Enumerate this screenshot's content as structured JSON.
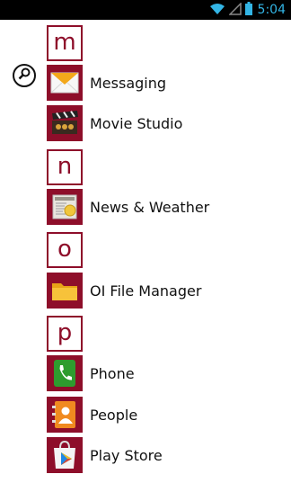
{
  "status_bar": {
    "time": "5:04",
    "icons": [
      "wifi-icon",
      "signal-icon",
      "battery-icon"
    ]
  },
  "search": {
    "icon": "search-icon"
  },
  "sections": [
    {
      "letter": "m",
      "apps": [
        {
          "label": "Messaging",
          "icon": "messaging-icon"
        },
        {
          "label": "Movie Studio",
          "icon": "movie-studio-icon"
        }
      ]
    },
    {
      "letter": "n",
      "apps": [
        {
          "label": "News & Weather",
          "icon": "news-weather-icon"
        }
      ]
    },
    {
      "letter": "o",
      "apps": [
        {
          "label": "OI File Manager",
          "icon": "folder-icon"
        }
      ]
    },
    {
      "letter": "p",
      "apps": [
        {
          "label": "Phone",
          "icon": "phone-icon"
        },
        {
          "label": "People",
          "icon": "people-icon"
        },
        {
          "label": "Play Store",
          "icon": "play-store-icon"
        }
      ]
    }
  ],
  "colors": {
    "accent": "#8e0e2a",
    "status_bar": "#000000",
    "clock": "#33b5e5"
  }
}
